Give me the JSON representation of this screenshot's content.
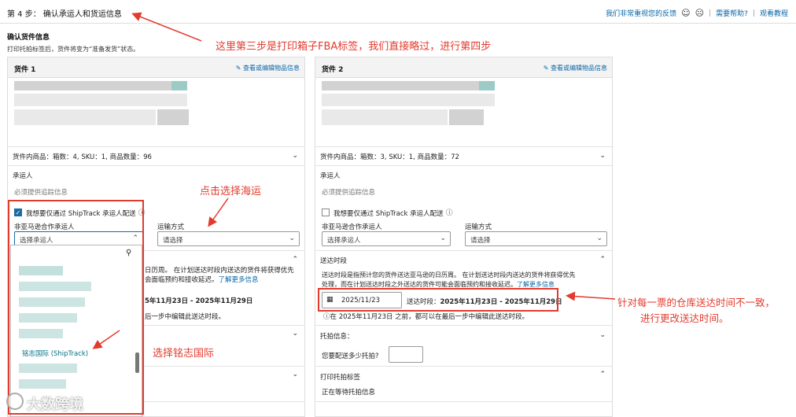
{
  "header": {
    "step_title": "第 4 步： 确认承运人和货运信息",
    "feedback_link": "我们非常重视您的反馈",
    "help_link": "需要帮助?",
    "tutorial_link": "观看教程"
  },
  "section": {
    "title": "确认货件信息",
    "desc": "打印托拍标签后，货件将变为“准备发货”状态。"
  },
  "shipments": [
    {
      "name": "货件 1",
      "edit_label": "查看或编辑物品信息",
      "summary": "货件内商品：箱数：4, SKU：1, 商品数量：96",
      "carrier_label": "承运人",
      "tracking_note": "必须提供追踪信息",
      "shiptrack_label": "我想要仅通过 ShipTrack 承运人配送",
      "non_partner_label": "非亚马逊合作承运人",
      "carrier_placeholder": "选择承运人",
      "transport_label": "运输方式",
      "transport_placeholder": "请选择",
      "window_desc_1": "日历周。 在计划送达时段内送达的货件将获得优先",
      "window_desc_2": "处理，而在计划送达时段之外送达的货件可能会面临预约和接收延迟。",
      "learn_more": "了解更多信息",
      "window_range": "5年11月23日 - 2025年11月29日",
      "window_note": "后一步中编辑此送达时段。"
    },
    {
      "name": "货件 2",
      "edit_label": "查看或编辑物品信息",
      "summary": "货件内商品：箱数：3, SKU：1, 商品数量：72",
      "carrier_label": "承运人",
      "tracking_note": "必须提供追踪信息",
      "shiptrack_label": "我想要仅通过 ShipTrack 承运人配送",
      "non_partner_label": "非亚马逊合作承运人",
      "carrier_placeholder": "选择承运人",
      "transport_label": "运输方式",
      "transport_placeholder": "请选择",
      "window_title": "送达时段",
      "window_desc_1": "送达时段是指预计您的货件送达亚马逊的日历周。 在计划送达时段内送达的货件将获得优先",
      "window_desc_2": "处理，而在计划送达时段之外送达的货件可能会面临预约和接收延迟。",
      "learn_more": "了解更多信息",
      "date_value": "2025/11/23",
      "window_prefix": "送达时段：",
      "window_range": "2025年11月23日 - 2025年11月29日",
      "window_note": "在 2025年11月23日 之前，都可以在最后一步中编辑此送达时段。",
      "pallet_title": "托拍信息：",
      "pallet_question": "您要配送多少托拍?",
      "print_title": "打印托拍标签",
      "print_status": "正在等待托拍信息"
    }
  ],
  "dropdown": {
    "highlight_item": "铭志国际 (ShipTrack)"
  },
  "annotations": {
    "skip_step": "这里第三步是打印箱子FBA标签，我们直接略过，进行第四步",
    "choose_sea": "点击选择海运",
    "choose_carrier": "选择铭志国际",
    "change_time_1": "针对每一票的仓库送达时间不一致，",
    "change_time_2": "进行更改送达时间。"
  },
  "watermark": "大数跨境",
  "colors": {
    "link": "#0a66a6",
    "annotation": "#e23b2e",
    "checkbox": "#1a6aa3",
    "highlight": "#007185"
  }
}
